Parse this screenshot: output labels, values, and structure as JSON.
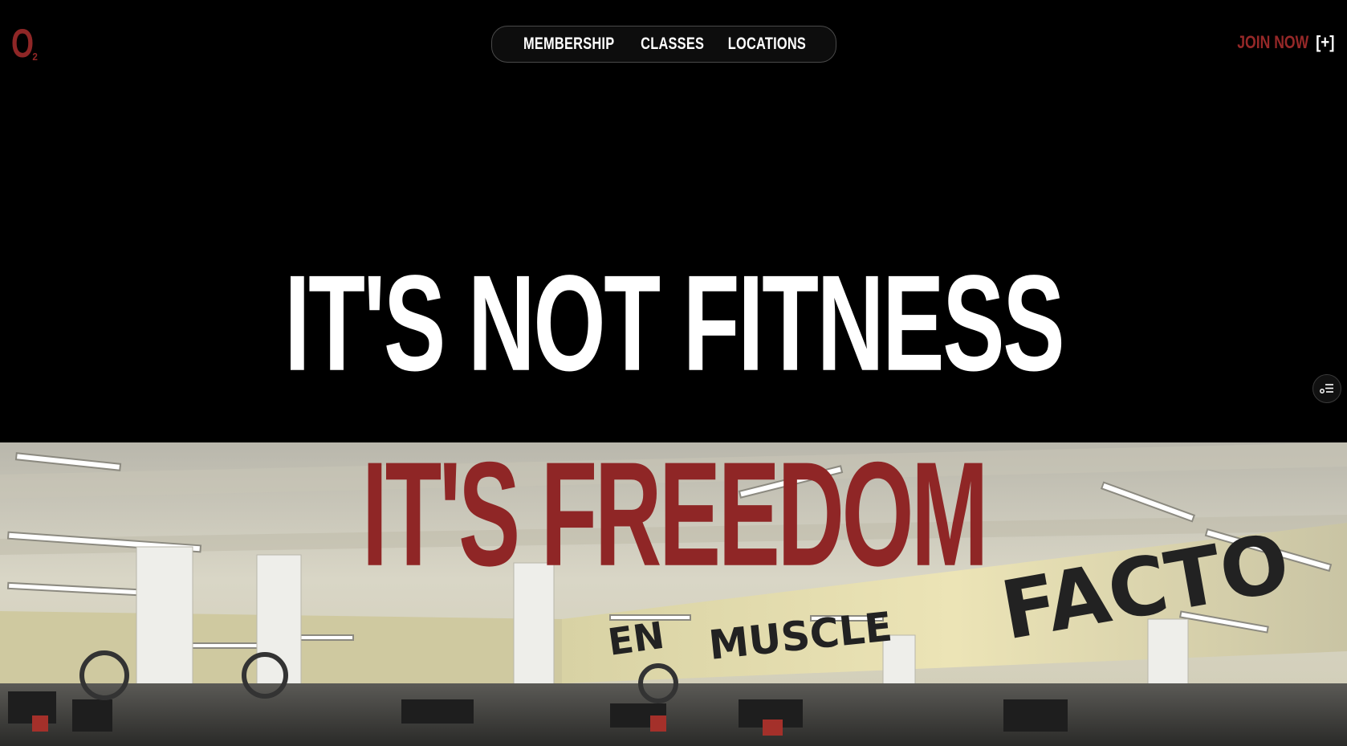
{
  "header": {
    "logo": {
      "main": "O",
      "sub": "2"
    },
    "nav": [
      {
        "label": "MEMBERSHIP"
      },
      {
        "label": "CLASSES"
      },
      {
        "label": "LOCATIONS"
      }
    ],
    "cta": {
      "label": "JOIN NOW",
      "icon": "[+]"
    }
  },
  "hero": {
    "headline": "IT'S NOT FITNESS",
    "subheadline": "IT'S FREEDOM",
    "background": "gym-interior-image",
    "sign_text": {
      "left": "EN",
      "muscle": "MUSCLE",
      "factory": "FACTO"
    }
  },
  "side_widget": {
    "icon": "accessibility-settings-icon"
  },
  "colors": {
    "brand": "#8f2626",
    "background": "#000000",
    "text": "#ffffff"
  }
}
